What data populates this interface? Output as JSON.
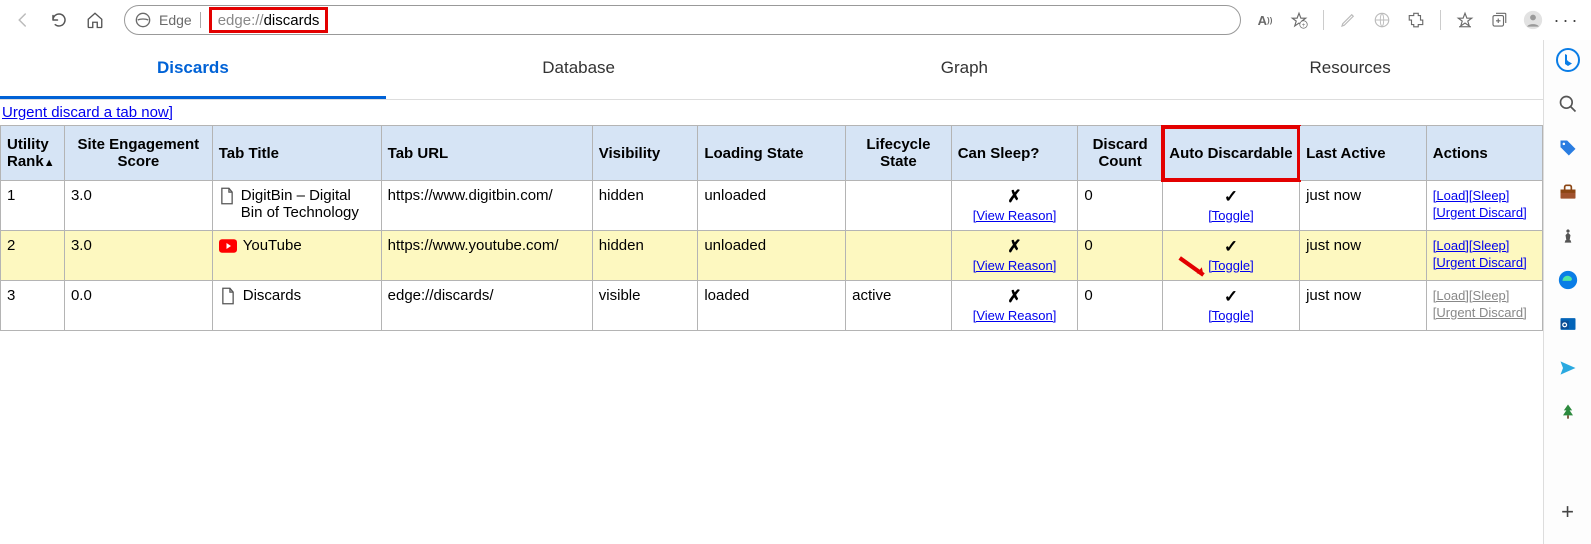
{
  "toolbar": {
    "edge_label": "Edge",
    "url_scheme": "edge://",
    "url_path": "discards"
  },
  "tabs": [
    {
      "label": "Discards",
      "active": true
    },
    {
      "label": "Database",
      "active": false
    },
    {
      "label": "Graph",
      "active": false
    },
    {
      "label": "Resources",
      "active": false
    }
  ],
  "urgent_link": "Urgent discard a tab now]",
  "table": {
    "headers": [
      "Utility Rank",
      "Site Engagement Score",
      "Tab Title",
      "Tab URL",
      "Visibility",
      "Loading State",
      "Lifecycle State",
      "Can Sleep?",
      "Discard Count",
      "Auto Discardable",
      "Last Active",
      "Actions"
    ],
    "can_sleep_view": "[View Reason]",
    "toggle_label": "[Toggle]",
    "load_label": "[Load]",
    "sleep_label": "[Sleep]",
    "urgent_discard_label": "[Urgent Discard]",
    "rows": [
      {
        "rank": "1",
        "score": "3.0",
        "icon": "file",
        "title": "DigitBin – Digital Bin of Technology",
        "url": "https://www.digitbin.com/",
        "visibility": "hidden",
        "loading": "unloaded",
        "lifecycle": "",
        "can_sleep": "✗",
        "discard_count": "0",
        "auto_discardable": "✓",
        "last_active": "just now",
        "actions_enabled": true,
        "highlight": false
      },
      {
        "rank": "2",
        "score": "3.0",
        "icon": "youtube",
        "title": "YouTube",
        "url": "https://www.youtube.com/",
        "visibility": "hidden",
        "loading": "unloaded",
        "lifecycle": "",
        "can_sleep": "✗",
        "discard_count": "0",
        "auto_discardable": "✓",
        "last_active": "just now",
        "actions_enabled": true,
        "highlight": true,
        "arrow": true
      },
      {
        "rank": "3",
        "score": "0.0",
        "icon": "file",
        "title": "Discards",
        "url": "edge://discards/",
        "visibility": "visible",
        "loading": "loaded",
        "lifecycle": "active",
        "can_sleep": "✗",
        "discard_count": "0",
        "auto_discardable": "✓",
        "last_active": "just now",
        "actions_enabled": false,
        "highlight": false
      }
    ]
  }
}
